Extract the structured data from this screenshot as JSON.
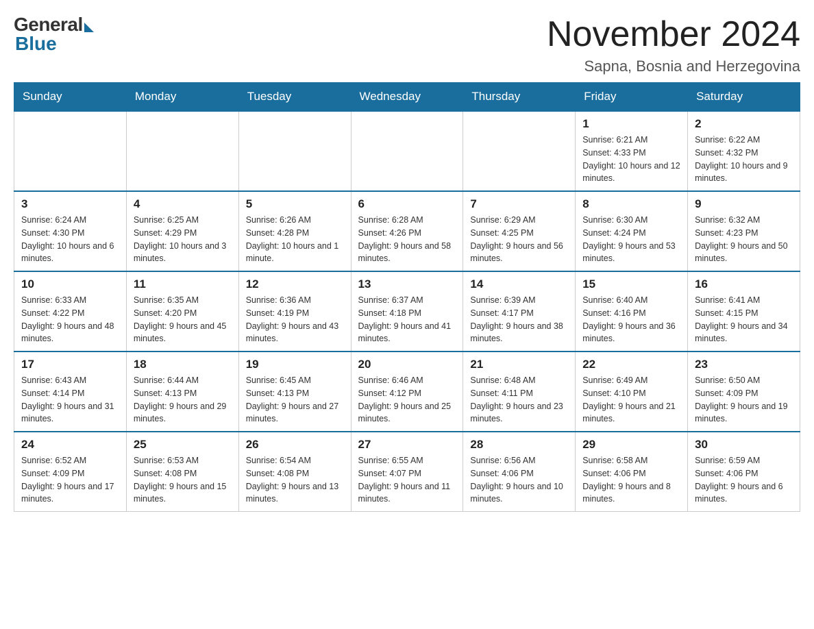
{
  "logo": {
    "general": "General",
    "blue": "Blue"
  },
  "title": "November 2024",
  "subtitle": "Sapna, Bosnia and Herzegovina",
  "days_of_week": [
    "Sunday",
    "Monday",
    "Tuesday",
    "Wednesday",
    "Thursday",
    "Friday",
    "Saturday"
  ],
  "weeks": [
    [
      {
        "day": "",
        "info": ""
      },
      {
        "day": "",
        "info": ""
      },
      {
        "day": "",
        "info": ""
      },
      {
        "day": "",
        "info": ""
      },
      {
        "day": "",
        "info": ""
      },
      {
        "day": "1",
        "info": "Sunrise: 6:21 AM\nSunset: 4:33 PM\nDaylight: 10 hours and 12 minutes."
      },
      {
        "day": "2",
        "info": "Sunrise: 6:22 AM\nSunset: 4:32 PM\nDaylight: 10 hours and 9 minutes."
      }
    ],
    [
      {
        "day": "3",
        "info": "Sunrise: 6:24 AM\nSunset: 4:30 PM\nDaylight: 10 hours and 6 minutes."
      },
      {
        "day": "4",
        "info": "Sunrise: 6:25 AM\nSunset: 4:29 PM\nDaylight: 10 hours and 3 minutes."
      },
      {
        "day": "5",
        "info": "Sunrise: 6:26 AM\nSunset: 4:28 PM\nDaylight: 10 hours and 1 minute."
      },
      {
        "day": "6",
        "info": "Sunrise: 6:28 AM\nSunset: 4:26 PM\nDaylight: 9 hours and 58 minutes."
      },
      {
        "day": "7",
        "info": "Sunrise: 6:29 AM\nSunset: 4:25 PM\nDaylight: 9 hours and 56 minutes."
      },
      {
        "day": "8",
        "info": "Sunrise: 6:30 AM\nSunset: 4:24 PM\nDaylight: 9 hours and 53 minutes."
      },
      {
        "day": "9",
        "info": "Sunrise: 6:32 AM\nSunset: 4:23 PM\nDaylight: 9 hours and 50 minutes."
      }
    ],
    [
      {
        "day": "10",
        "info": "Sunrise: 6:33 AM\nSunset: 4:22 PM\nDaylight: 9 hours and 48 minutes."
      },
      {
        "day": "11",
        "info": "Sunrise: 6:35 AM\nSunset: 4:20 PM\nDaylight: 9 hours and 45 minutes."
      },
      {
        "day": "12",
        "info": "Sunrise: 6:36 AM\nSunset: 4:19 PM\nDaylight: 9 hours and 43 minutes."
      },
      {
        "day": "13",
        "info": "Sunrise: 6:37 AM\nSunset: 4:18 PM\nDaylight: 9 hours and 41 minutes."
      },
      {
        "day": "14",
        "info": "Sunrise: 6:39 AM\nSunset: 4:17 PM\nDaylight: 9 hours and 38 minutes."
      },
      {
        "day": "15",
        "info": "Sunrise: 6:40 AM\nSunset: 4:16 PM\nDaylight: 9 hours and 36 minutes."
      },
      {
        "day": "16",
        "info": "Sunrise: 6:41 AM\nSunset: 4:15 PM\nDaylight: 9 hours and 34 minutes."
      }
    ],
    [
      {
        "day": "17",
        "info": "Sunrise: 6:43 AM\nSunset: 4:14 PM\nDaylight: 9 hours and 31 minutes."
      },
      {
        "day": "18",
        "info": "Sunrise: 6:44 AM\nSunset: 4:13 PM\nDaylight: 9 hours and 29 minutes."
      },
      {
        "day": "19",
        "info": "Sunrise: 6:45 AM\nSunset: 4:13 PM\nDaylight: 9 hours and 27 minutes."
      },
      {
        "day": "20",
        "info": "Sunrise: 6:46 AM\nSunset: 4:12 PM\nDaylight: 9 hours and 25 minutes."
      },
      {
        "day": "21",
        "info": "Sunrise: 6:48 AM\nSunset: 4:11 PM\nDaylight: 9 hours and 23 minutes."
      },
      {
        "day": "22",
        "info": "Sunrise: 6:49 AM\nSunset: 4:10 PM\nDaylight: 9 hours and 21 minutes."
      },
      {
        "day": "23",
        "info": "Sunrise: 6:50 AM\nSunset: 4:09 PM\nDaylight: 9 hours and 19 minutes."
      }
    ],
    [
      {
        "day": "24",
        "info": "Sunrise: 6:52 AM\nSunset: 4:09 PM\nDaylight: 9 hours and 17 minutes."
      },
      {
        "day": "25",
        "info": "Sunrise: 6:53 AM\nSunset: 4:08 PM\nDaylight: 9 hours and 15 minutes."
      },
      {
        "day": "26",
        "info": "Sunrise: 6:54 AM\nSunset: 4:08 PM\nDaylight: 9 hours and 13 minutes."
      },
      {
        "day": "27",
        "info": "Sunrise: 6:55 AM\nSunset: 4:07 PM\nDaylight: 9 hours and 11 minutes."
      },
      {
        "day": "28",
        "info": "Sunrise: 6:56 AM\nSunset: 4:06 PM\nDaylight: 9 hours and 10 minutes."
      },
      {
        "day": "29",
        "info": "Sunrise: 6:58 AM\nSunset: 4:06 PM\nDaylight: 9 hours and 8 minutes."
      },
      {
        "day": "30",
        "info": "Sunrise: 6:59 AM\nSunset: 4:06 PM\nDaylight: 9 hours and 6 minutes."
      }
    ]
  ]
}
